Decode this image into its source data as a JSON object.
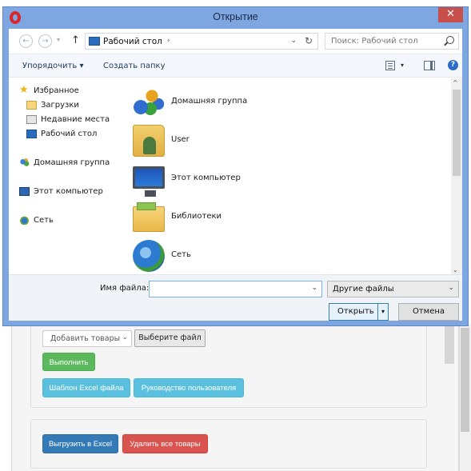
{
  "dialog": {
    "title": "Открытие",
    "close_glyph": "✕",
    "address": {
      "location": "Рабочий стол",
      "separator": "›",
      "dropdown_glyph": "⌄",
      "refresh_glyph": "↻",
      "back_glyph": "←",
      "forward_glyph": "→",
      "up_glyph": "↑",
      "history_glyph": "▾"
    },
    "search": {
      "placeholder": "Поиск: Рабочий стол"
    },
    "toolbar": {
      "organize": "Упорядочить ▾",
      "new_folder": "Создать папку",
      "view_drop": "▾",
      "help": "?"
    },
    "nav_pane": {
      "items": [
        {
          "label": "Избранное",
          "icon": "star-icon"
        },
        {
          "label": "Загрузки",
          "icon": "downloads-folder-icon"
        },
        {
          "label": "Недавние места",
          "icon": "recent-places-icon"
        },
        {
          "label": "Рабочий стол",
          "icon": "desktop-icon"
        },
        {
          "label": "Домашняя группа",
          "icon": "homegroup-icon"
        },
        {
          "label": "Этот компьютер",
          "icon": "computer-icon"
        },
        {
          "label": "Сеть",
          "icon": "network-icon"
        }
      ]
    },
    "files": [
      {
        "name": "Домашняя группа",
        "icon": "homegroup-icon"
      },
      {
        "name": "User",
        "icon": "user-folder-icon"
      },
      {
        "name": "Этот компьютер",
        "icon": "computer-icon"
      },
      {
        "name": "Библиотеки",
        "icon": "libraries-icon"
      },
      {
        "name": "Сеть",
        "icon": "network-icon"
      }
    ],
    "scroll": {
      "up": "^",
      "down": "⌄"
    },
    "bottom": {
      "filename_label": "Имя файла:",
      "filename_value": "",
      "filename_caret": "⌄",
      "filetype_value": "Другие файлы",
      "filetype_caret": "⌄",
      "open_label": "Открыть",
      "open_split": "▾",
      "cancel_label": "Отмена"
    }
  },
  "page": {
    "add_select": "Добавить товары",
    "add_caret": "⌄",
    "choose_file": "Выберите файл",
    "run": "Выполнить",
    "template": "Шаблон Excel файла",
    "guide": "Руководство пользователя",
    "export": "Выгрузить в Excel",
    "delete_all": "Удалить все товары"
  },
  "colors": {
    "title_bar": "#7ea6e0",
    "close_button": "#c7504a",
    "success": "#5cb85c",
    "info": "#5bc0de",
    "primary": "#337ab7",
    "danger": "#d9534f"
  }
}
